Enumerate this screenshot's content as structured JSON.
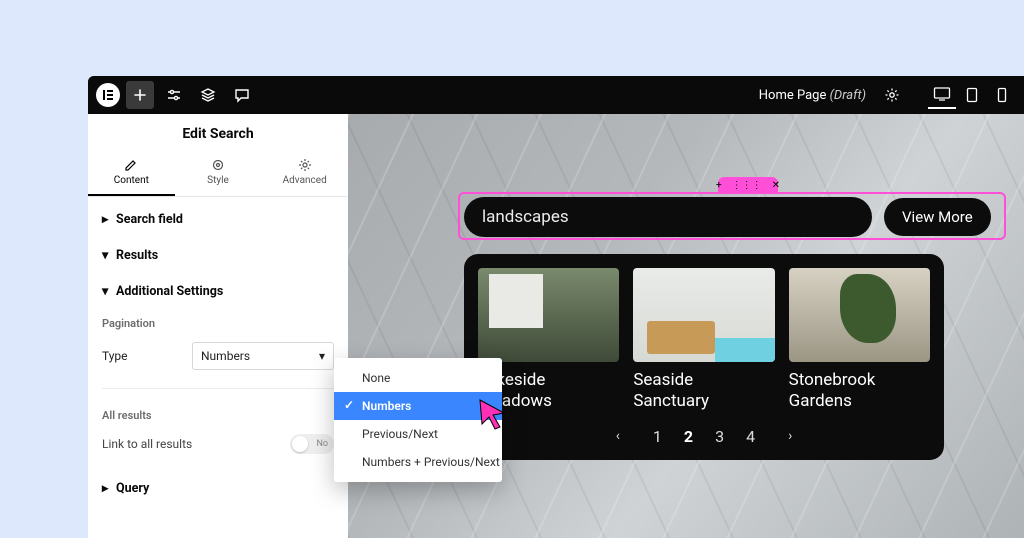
{
  "topbar": {
    "page_title": "Home Page",
    "page_status": "(Draft)"
  },
  "panel": {
    "title": "Edit Search",
    "tabs": {
      "content": "Content",
      "style": "Style",
      "advanced": "Advanced"
    },
    "sections": {
      "search_field": "Search field",
      "results": "Results",
      "additional_settings": "Additional Settings",
      "pagination_label": "Pagination",
      "type_label": "Type",
      "type_value": "Numbers",
      "all_results_label": "All results",
      "link_all_label": "Link to all results",
      "toggle_value": "No",
      "query": "Query"
    },
    "dropdown": {
      "options": [
        "None",
        "Numbers",
        "Previous/Next",
        "Numbers + Previous/Next"
      ],
      "selected_index": 1
    }
  },
  "canvas": {
    "search_value": "landscapes",
    "view_more": "View More",
    "results": [
      {
        "title_line1": "Lakeside",
        "title_line2": "Meadows"
      },
      {
        "title_line1": "Seaside",
        "title_line2": "Sanctuary"
      },
      {
        "title_line1": "Stonebrook",
        "title_line2": "Gardens"
      }
    ],
    "pages": [
      "1",
      "2",
      "3",
      "4"
    ],
    "current_page": "2"
  }
}
